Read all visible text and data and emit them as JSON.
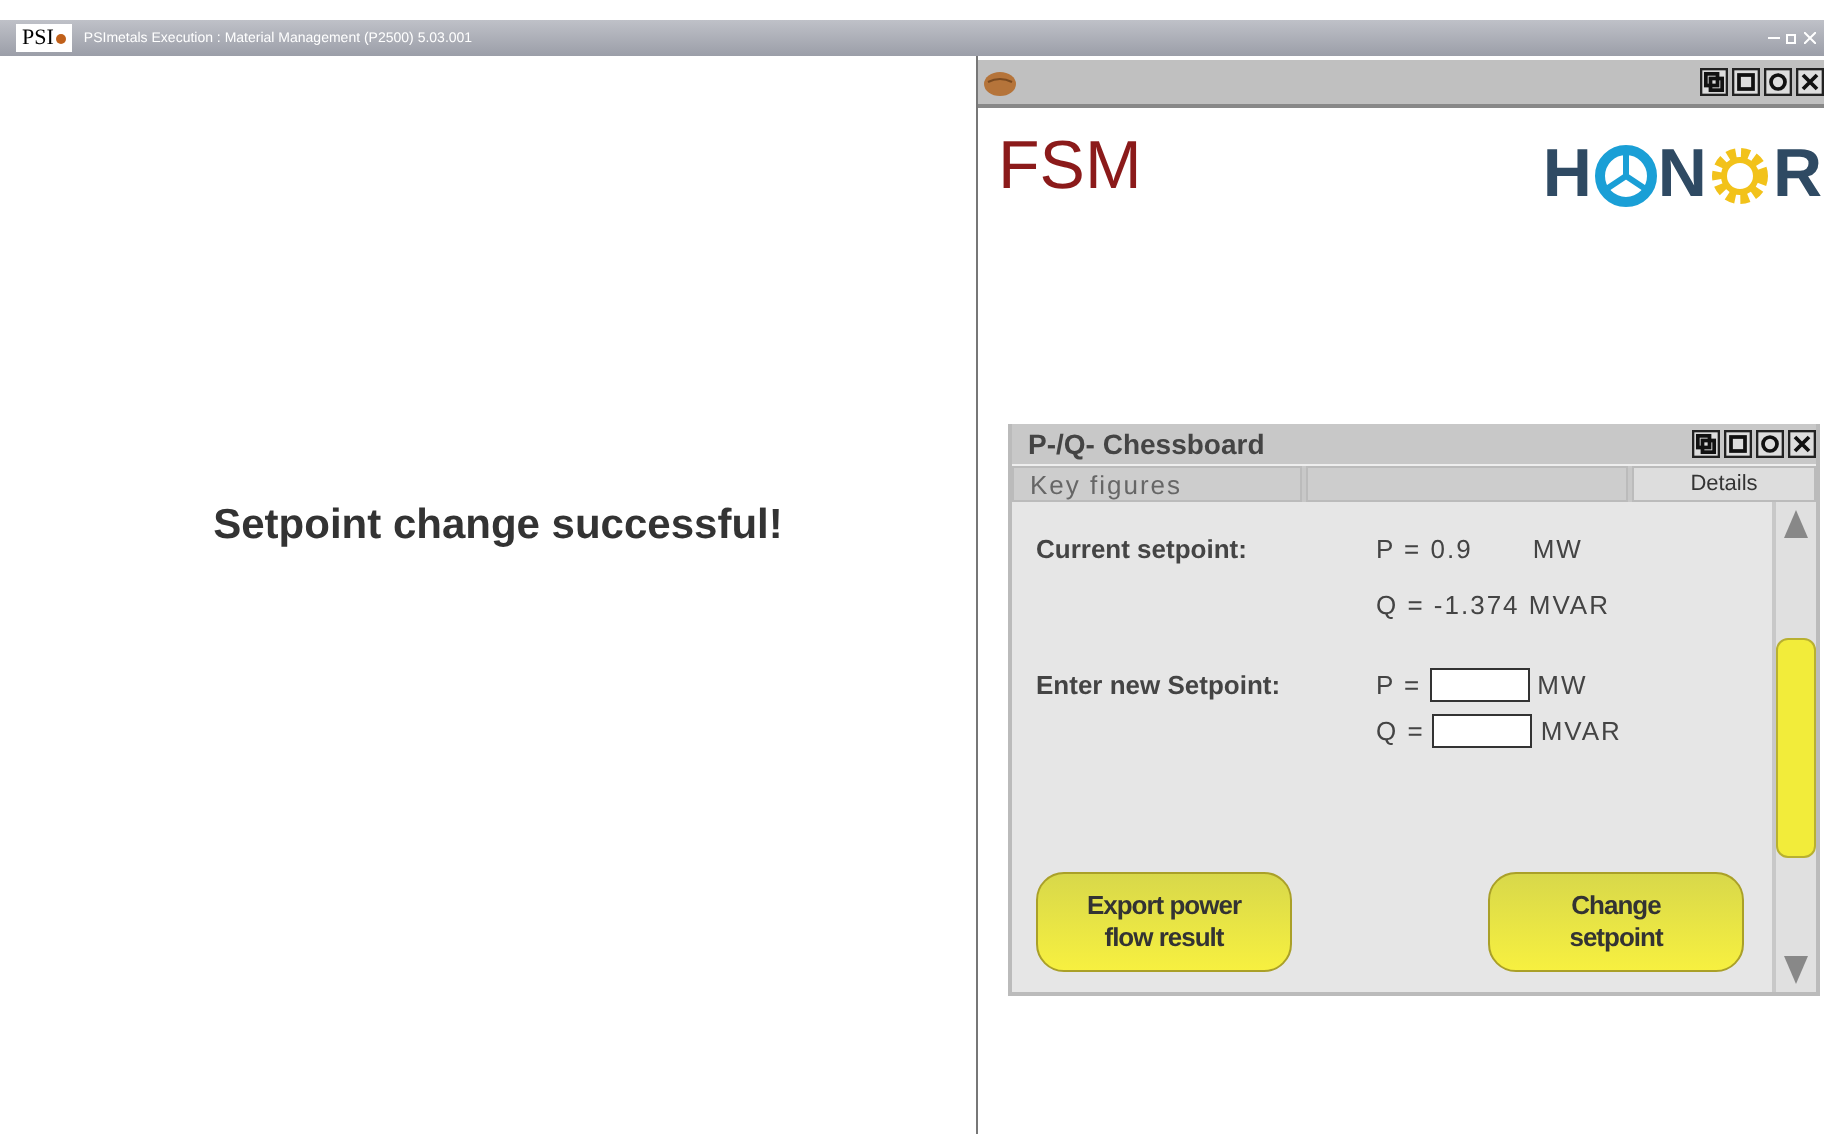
{
  "window": {
    "logo": "PSI",
    "title": "PSImetals Execution : Material Management (P2500) 5.03.001"
  },
  "message": "Setpoint change successful!",
  "right_window": {
    "app_title": "FSM",
    "logo_letters": [
      "H",
      "N",
      "R"
    ],
    "panel": {
      "title": "P-/Q- Chessboard",
      "tabs": [
        {
          "label": "Key figures",
          "selected": false
        },
        {
          "label": "Details",
          "selected": true
        }
      ],
      "current_label": "Current setpoint:",
      "current_p": "P = 0.9",
      "current_p_unit": "MW",
      "current_q": "Q = -1.374 MVAR",
      "new_label": "Enter new Setpoint:",
      "inputs": [
        {
          "label": "P =",
          "unit": "MW"
        },
        {
          "label": "Q =",
          "unit": "MVAR"
        }
      ],
      "buttons": [
        "Export power flow result",
        "Change setpoint"
      ]
    }
  }
}
